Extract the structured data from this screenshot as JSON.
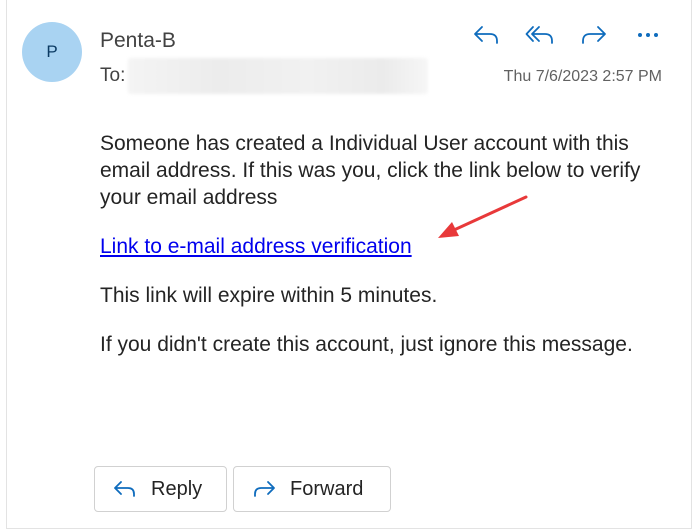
{
  "header": {
    "avatar_initial": "P",
    "sender": "Penta-B",
    "to_label": "To:",
    "date": "Thu 7/6/2023 2:57 PM",
    "actions": [
      "reply-icon",
      "reply-all-icon",
      "forward-icon",
      "more-icon"
    ]
  },
  "message": {
    "paragraph1": "Someone has created a Individual User account with this email address. If this was you, click the link below to verify your email address",
    "link": "Link to e-mail address verification",
    "paragraph2": "This link will expire within 5 minutes.",
    "paragraph3": "If you didn't create this account, just ignore this message."
  },
  "footer": {
    "reply_label": "Reply",
    "forward_label": "Forward"
  },
  "colors": {
    "accent": "#0f6cbd",
    "avatar_bg": "#a9d3f2",
    "link": "#0000ee",
    "annotation_arrow": "#e8393a"
  }
}
